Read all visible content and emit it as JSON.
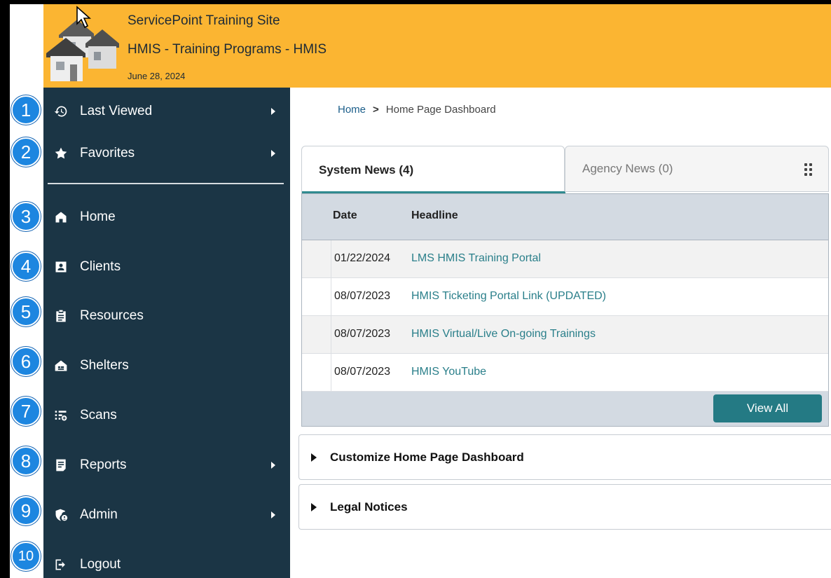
{
  "header": {
    "site_name": "ServicePoint Training Site",
    "provider": "HMIS - Training Programs - HMIS",
    "date": "June 28, 2024"
  },
  "sidebar": {
    "items": [
      {
        "label": "Last Viewed",
        "icon": "history-icon",
        "badge": "1",
        "has_arrow": true
      },
      {
        "label": "Favorites",
        "icon": "star-icon",
        "badge": "2",
        "has_arrow": true
      },
      {
        "label": "Home",
        "icon": "home-icon",
        "badge": "3",
        "has_arrow": false
      },
      {
        "label": "Clients",
        "icon": "client-card-icon",
        "badge": "4",
        "has_arrow": false
      },
      {
        "label": "Resources",
        "icon": "clipboard-icon",
        "badge": "5",
        "has_arrow": false
      },
      {
        "label": "Shelters",
        "icon": "shelter-icon",
        "badge": "6",
        "has_arrow": false
      },
      {
        "label": "Scans",
        "icon": "scan-list-icon",
        "badge": "7",
        "has_arrow": false
      },
      {
        "label": "Reports",
        "icon": "report-icon",
        "badge": "8",
        "has_arrow": true
      },
      {
        "label": "Admin",
        "icon": "admin-shield-icon",
        "badge": "9",
        "has_arrow": true
      },
      {
        "label": "Logout",
        "icon": "logout-icon",
        "badge": "10",
        "has_arrow": false
      }
    ]
  },
  "breadcrumb": {
    "home": "Home",
    "separator": ">",
    "current": "Home Page Dashboard"
  },
  "news": {
    "tabs": [
      {
        "label": "System News (4)",
        "active": true
      },
      {
        "label": "Agency News (0)",
        "active": false
      }
    ],
    "columns": [
      "Date",
      "Headline"
    ],
    "rows": [
      {
        "date": "01/22/2024",
        "headline": "LMS HMIS Training Portal"
      },
      {
        "date": "08/07/2023",
        "headline": "HMIS Ticketing Portal Link (UPDATED)"
      },
      {
        "date": "08/07/2023",
        "headline": "HMIS Virtual/Live On-going Trainings"
      },
      {
        "date": "08/07/2023",
        "headline": "HMIS YouTube"
      }
    ],
    "view_all_label": "View All"
  },
  "sections": [
    {
      "label": "Customize Home Page Dashboard"
    },
    {
      "label": "Legal Notices"
    }
  ],
  "colors": {
    "header_bg": "#fbb532",
    "sidebar_bg": "#1b3545",
    "accent": "#247a84",
    "badge": "#1d86e0"
  }
}
